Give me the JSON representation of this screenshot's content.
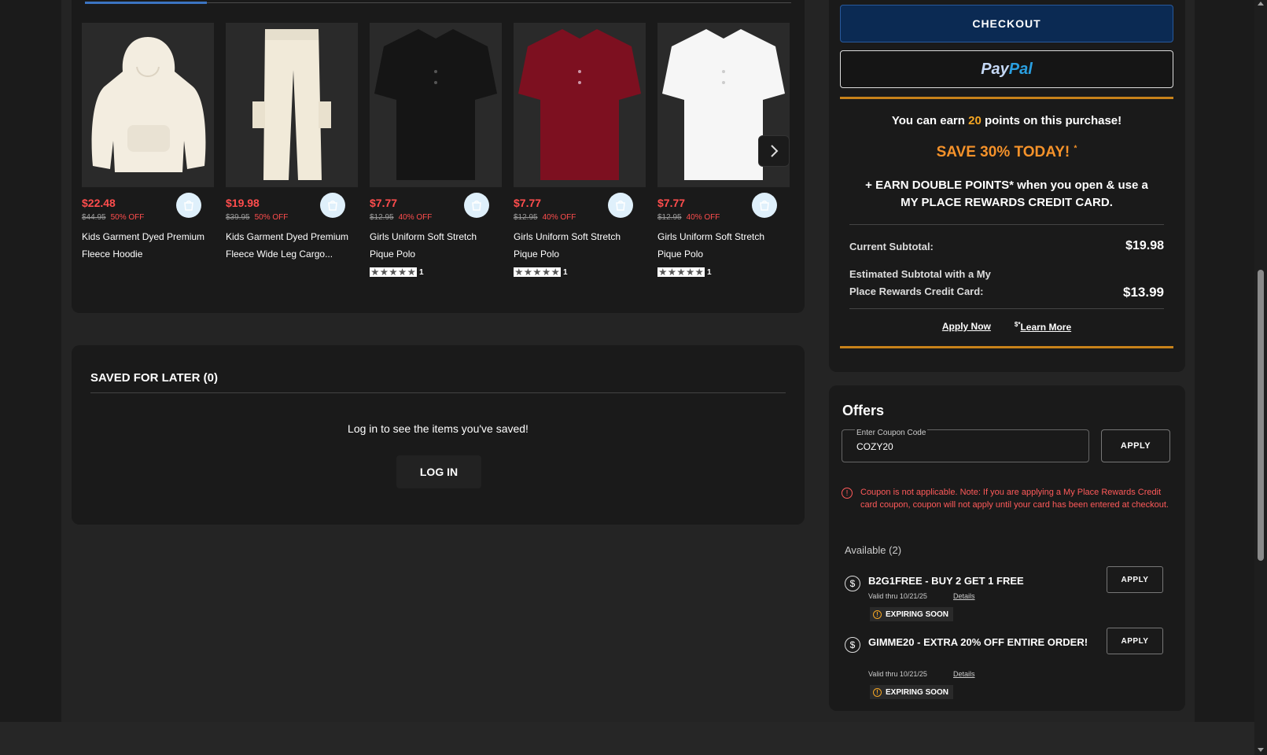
{
  "recommendations": {
    "products": [
      {
        "price": "$22.48",
        "orig": "$44.95",
        "off": "50% OFF",
        "name": "Kids Garment Dyed Premium Fleece Hoodie",
        "rating_count": ""
      },
      {
        "price": "$19.98",
        "orig": "$39.95",
        "off": "50% OFF",
        "name": "Kids Garment Dyed Premium Fleece Wide Leg Cargo...",
        "rating_count": ""
      },
      {
        "price": "$7.77",
        "orig": "$12.95",
        "off": "40% OFF",
        "name": "Girls Uniform Soft Stretch Pique Polo",
        "rating_count": "1"
      },
      {
        "price": "$7.77",
        "orig": "$12.95",
        "off": "40% OFF",
        "name": "Girls Uniform Soft Stretch Pique Polo",
        "rating_count": "1"
      },
      {
        "price": "$7.77",
        "orig": "$12.95",
        "off": "40% OFF",
        "name": "Girls Uniform Soft Stretch Pique Polo",
        "rating_count": "1"
      }
    ]
  },
  "saved": {
    "title": "SAVED FOR LATER (0)",
    "message": "Log in to see the items you've saved!",
    "login_label": "LOG IN"
  },
  "checkout": {
    "checkout_label": "CHECKOUT",
    "paypal_pay": "Pay",
    "paypal_pal": "Pal",
    "earn_prefix": "You can earn ",
    "earn_points": "20",
    "earn_suffix": " points on this purchase!",
    "save_today": "SAVE 30% TODAY!",
    "save_mark": "*",
    "double_points": "+ EARN DOUBLE POINTS* when you open & use a MY PLACE REWARDS CREDIT CARD.",
    "current_subtotal_label": "Current Subtotal:",
    "current_subtotal": "$19.98",
    "estimated_label": "Estimated Subtotal with a My Place Rewards Credit Card:",
    "estimated_subtotal": "$13.99",
    "apply_now": "Apply Now",
    "learn_more_mark": "$*",
    "learn_more": "Learn More"
  },
  "offers": {
    "title": "Offers",
    "coupon_label": "Enter Coupon Code",
    "coupon_value": "COZY20",
    "apply_label": "APPLY",
    "error": "Coupon is not applicable. Note: If you are applying a My Place Rewards Credit card coupon, coupon will not apply until your card has been entered at checkout.",
    "available": "Available (2)",
    "coupons": [
      {
        "title": "B2G1FREE - BUY 2 GET 1 FREE",
        "valid": "Valid thru 10/21/25",
        "details": "Details",
        "badge": "EXPIRING SOON",
        "apply": "APPLY"
      },
      {
        "title": "GIMME20 - EXTRA 20% OFF ENTIRE ORDER!",
        "valid": "Valid thru 10/21/25",
        "details": "Details",
        "badge": "EXPIRING SOON",
        "apply": "APPLY"
      }
    ]
  },
  "colors": {
    "accent_blue": "#0b2a53",
    "orange": "#c8821a",
    "sale_red": "#ff4d4d",
    "points": "#f5a623"
  }
}
